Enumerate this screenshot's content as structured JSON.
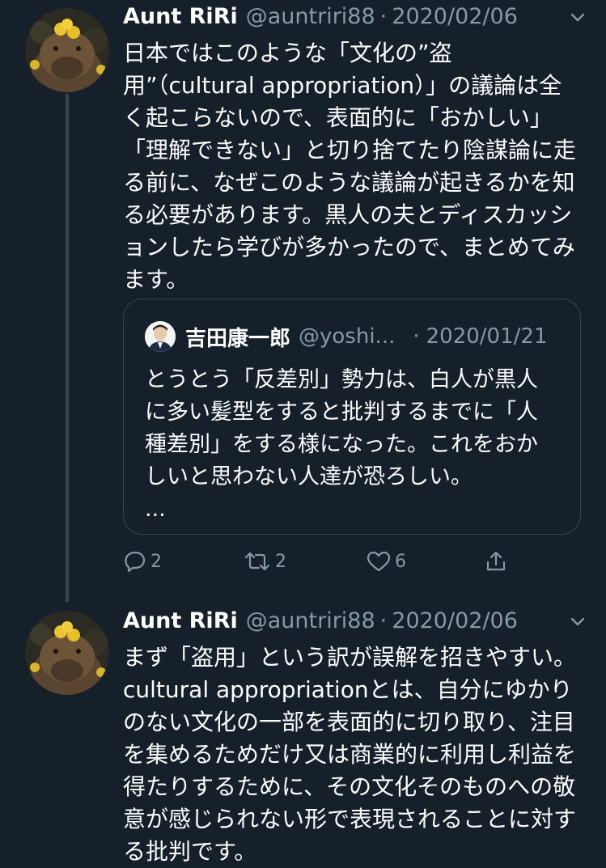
{
  "tweets": [
    {
      "name": "Aunt RiRi",
      "handle": "@auntriri88",
      "separator": "·",
      "date": "2020/02/06",
      "text": "日本ではこのような「文化の”盗\n用”（cultural appropriation）」の議論は全\nく起こらないので、表面的に「おかしい」\n「理解できない」と切り捨てたり陰謀論に走\nる前に、なぜこのような議論が起きるかを知\nる必要があります。黒人の夫とディスカッシ\nョンしたら学びが多かったので、まとめてみ\nます。",
      "quote": {
        "name": "吉田康一郎",
        "handle": "@yoshi...",
        "separator": "·",
        "date": "2020/01/21",
        "text": "とうとう「反差別」勢力は、白人が黒人\nに多い髪型をすると批判するまでに「人\n種差別」をする様になった。これをおか\nしいと思わない人達が恐ろしい。\n..."
      },
      "actions": {
        "replies": "2",
        "retweets": "2",
        "likes": "6"
      }
    },
    {
      "name": "Aunt RiRi",
      "handle": "@auntriri88",
      "separator": "·",
      "date": "2020/02/06",
      "text": "まず「盗用」という訳が誤解を招きやすい。\ncultural appropriationとは、自分にゆかり\nのない文化の一部を表面的に切り取り、注目\nを集めるためだけ又は商業的に利用し利益を\n得たりするために、その文化そのものへの敬\n意が感じられない形で表現されることに対す\nる批判です。"
    }
  ],
  "colors": {
    "background": "#15202b",
    "secondary_text": "#8899a6",
    "border": "#38444d"
  },
  "icons": {
    "caret": "chevron-down-icon",
    "reply": "reply-icon",
    "retweet": "retweet-icon",
    "like": "heart-icon",
    "share": "share-icon"
  }
}
